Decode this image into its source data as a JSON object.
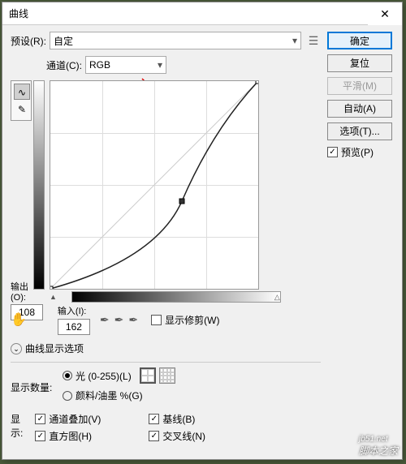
{
  "title": "曲线",
  "preset": {
    "label": "预设(R):",
    "value": "自定"
  },
  "channel": {
    "label": "通道(C):",
    "value": "RGB"
  },
  "buttons": {
    "ok": "确定",
    "cancel": "复位",
    "smooth": "平滑(M)",
    "auto": "自动(A)",
    "options": "选项(T)..."
  },
  "preview": {
    "label": "预览(P)"
  },
  "output": {
    "label": "输出(O):",
    "value": "108"
  },
  "input": {
    "label": "输入(I):",
    "value": "162"
  },
  "show_clipping": "显示修剪(W)",
  "disclosure_label": "曲线显示选项",
  "show_amount": {
    "label": "显示数量:",
    "light": "光 (0-255)(L)",
    "pigment": "颜料/油墨 %(G)"
  },
  "show": {
    "label": "显示:",
    "overlay": "通道叠加(V)",
    "baseline": "基线(B)",
    "histogram": "直方图(H)",
    "intersection": "交叉线(N)"
  },
  "watermark": "脚本之家",
  "watermark_url": "jb51.net",
  "chart_data": {
    "type": "line",
    "title": "Tone Curve",
    "xlabel": "输入",
    "ylabel": "输出",
    "xlim": [
      0,
      255
    ],
    "ylim": [
      0,
      255
    ],
    "series": [
      {
        "name": "curve",
        "points": [
          [
            0,
            0
          ],
          [
            162,
            108
          ],
          [
            255,
            255
          ]
        ]
      },
      {
        "name": "baseline",
        "points": [
          [
            0,
            0
          ],
          [
            255,
            255
          ]
        ]
      }
    ]
  }
}
